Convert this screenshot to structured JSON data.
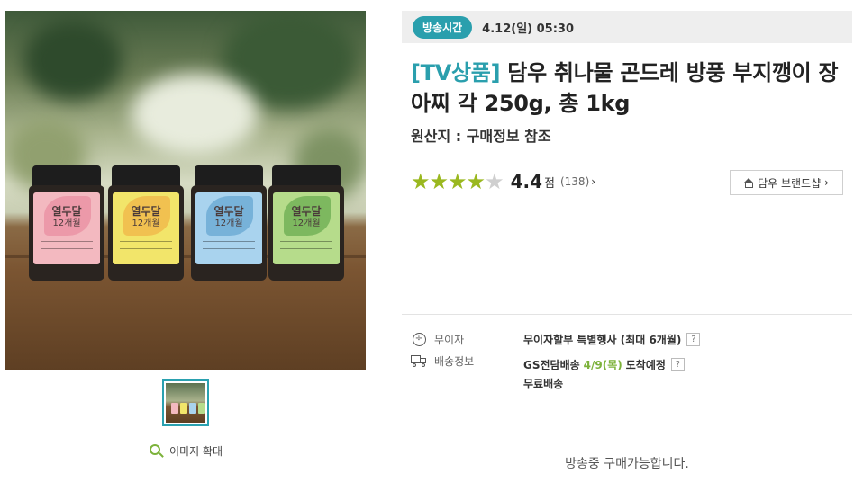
{
  "gallery": {
    "zoom_label": "이미지 확대",
    "jars": [
      {
        "title": "열두달",
        "subtitle": "12개월",
        "label_color": "#f3b9c0",
        "leaf_color": "#e57f95"
      },
      {
        "title": "열두달",
        "subtitle": "12개월",
        "label_color": "#f2e56a",
        "leaf_color": "#f0a43a"
      },
      {
        "title": "열두달",
        "subtitle": "12개월",
        "label_color": "#a9d3ee",
        "leaf_color": "#4f97c9"
      },
      {
        "title": "열두달",
        "subtitle": "12개월",
        "label_color": "#b6dc8b",
        "leaf_color": "#4f9a3c"
      }
    ]
  },
  "broadcast": {
    "badge": "방송시간",
    "time": "4.12(일) 05:30"
  },
  "product": {
    "tag": "[TV상품]",
    "name": " 담우 취나물 곤드레 방풍 부지깽이 장아찌 각 250g, 총 1kg",
    "origin": "원산지 : 구매정보 참조"
  },
  "rating": {
    "stars_filled": 4,
    "stars_total": 5,
    "score": "4.4",
    "score_unit": "점",
    "count": "(138)",
    "chevron": "›"
  },
  "brand_shop": {
    "label": "담우  브랜드샵",
    "chevron": "›"
  },
  "info": {
    "installment_label": "무이자",
    "installment_value": "무이자할부 특별행사 (최대 6개월)",
    "delivery_label": "배송정보",
    "delivery_prefix": "GS전담배송",
    "delivery_date": "4/9(목)",
    "delivery_suffix": "도착예정",
    "delivery_fee": "무료배송",
    "help": "?"
  },
  "on_air_text": "방송중 구매가능합니다.",
  "colors": {
    "accent_teal": "#2a9fad",
    "star_green": "#9ab81f",
    "date_green": "#7cb23a"
  }
}
